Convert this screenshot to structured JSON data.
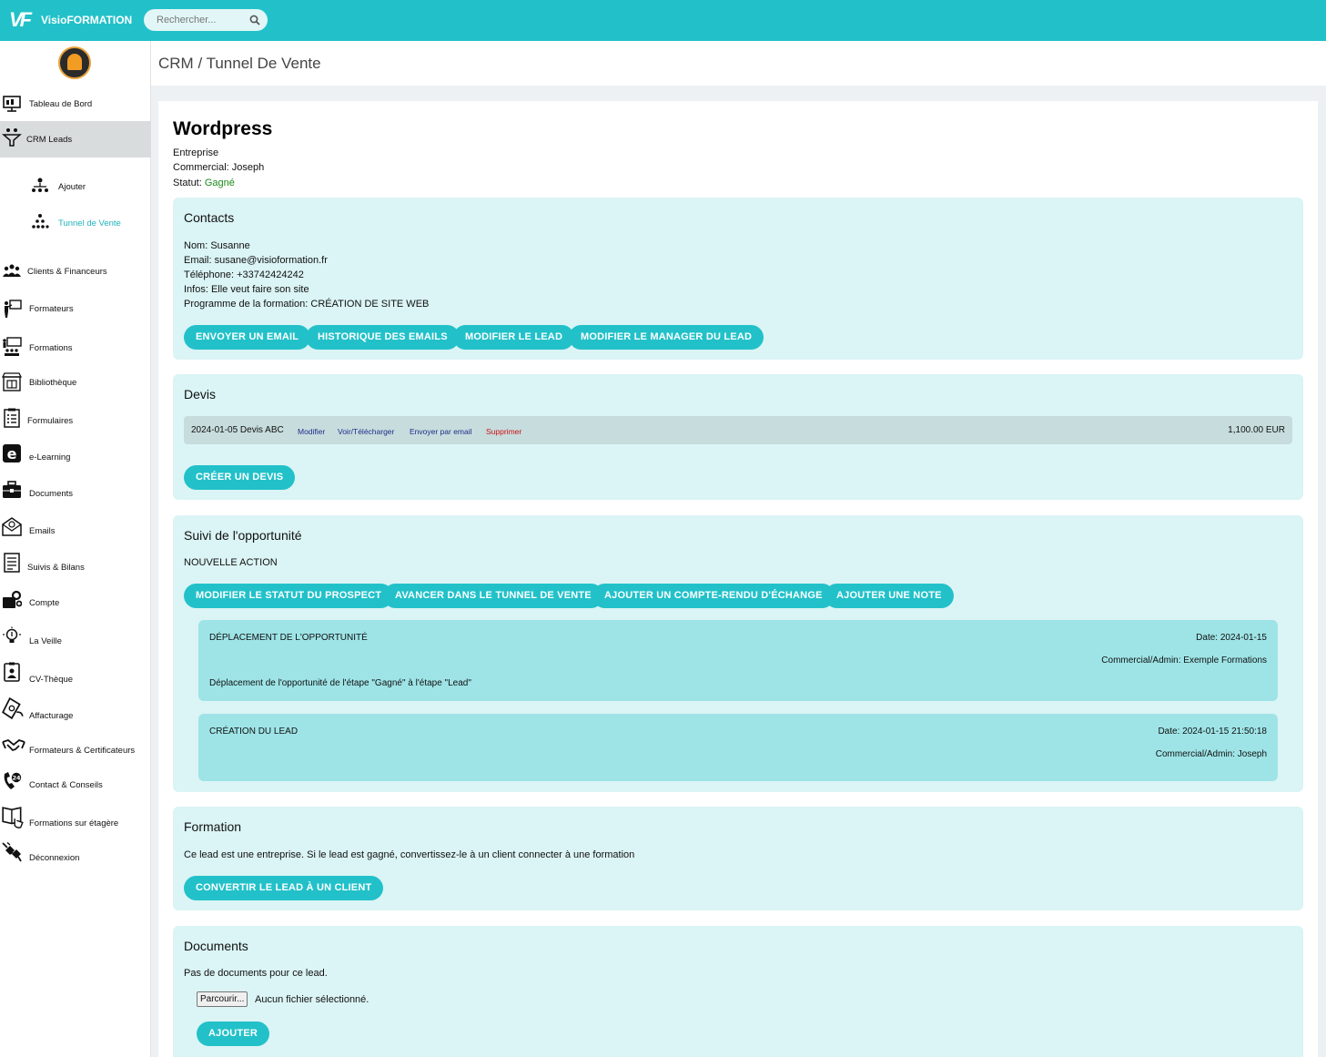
{
  "app": {
    "logo_mark": "VF",
    "logo_text": "VisioFORMATION",
    "brand_color": "#22c1c9"
  },
  "search": {
    "placeholder": "Rechercher..."
  },
  "breadcrumb": "CRM / Tunnel De Vente",
  "sidebar": {
    "items": [
      {
        "label": "Tableau de Bord",
        "icon": "dashboard-icon"
      },
      {
        "label": "CRM Leads",
        "icon": "funnel-people-icon",
        "active": true
      },
      {
        "label": "Clients & Financeurs",
        "icon": "people-group-icon"
      },
      {
        "label": "Formateurs",
        "icon": "trainer-board-icon"
      },
      {
        "label": "Formations",
        "icon": "classroom-icon"
      },
      {
        "label": "Bibliothèque",
        "icon": "library-icon"
      },
      {
        "label": "Formulaires",
        "icon": "clipboard-list-icon"
      },
      {
        "label": "e-Learning",
        "icon": "elearning-icon"
      },
      {
        "label": "Documents",
        "icon": "briefcase-icon"
      },
      {
        "label": "Emails",
        "icon": "envelope-icon"
      },
      {
        "label": "Suivis & Bilans",
        "icon": "report-icon"
      },
      {
        "label": "Compte",
        "icon": "account-gears-icon"
      },
      {
        "label": "La Veille",
        "icon": "lightbulb-icon"
      },
      {
        "label": "CV-Thèque",
        "icon": "id-badge-icon"
      },
      {
        "label": "Affacturage",
        "icon": "money-hand-icon"
      },
      {
        "label": "Formateurs & Certificateurs",
        "icon": "handshake-icon"
      },
      {
        "label": "Contact & Conseils",
        "icon": "phone-24-icon"
      },
      {
        "label": "Formations sur étagère",
        "icon": "book-hand-icon"
      },
      {
        "label": "Déconnexion",
        "icon": "plug-icon"
      }
    ],
    "sub_items": [
      {
        "label": "Ajouter",
        "icon": "org-chart-icon",
        "color": "#111111"
      },
      {
        "label": "Tunnel de Vente",
        "icon": "pyramid-people-icon",
        "color": "#22b3bb"
      }
    ]
  },
  "lead": {
    "title": "Wordpress",
    "type": "Entreprise",
    "commercial": "Commercial: Joseph",
    "status_label": "Statut: ",
    "status_value": "Gagné"
  },
  "contacts": {
    "title": "Contacts",
    "lines": [
      "Nom: Susanne",
      "Email: susane@visioformation.fr",
      "Téléphone: +33742424242",
      "Infos: Elle veut faire son site",
      "Programme de la formation: CRÉATION DE SITE WEB"
    ],
    "buttons": [
      "ENVOYER UN EMAIL",
      "HISTORIQUE DES EMAILS",
      "MODIFIER LE LEAD",
      "MODIFIER LE MANAGER DU LEAD"
    ]
  },
  "devis": {
    "title": "Devis",
    "row": {
      "name": "2024-01-05 Devis ABC",
      "edit": "Modifier",
      "view": "Voir/Télécharger",
      "send": "Envoyer par email",
      "delete": "Supprimer",
      "amount": "1,100.00 EUR"
    },
    "create_button": "CRÉER UN DEVIS"
  },
  "suivi": {
    "title": "Suivi de l'opportunité",
    "new_action": "NOUVELLE ACTION",
    "buttons": [
      "MODIFIER LE STATUT DU PROSPECT",
      "AVANCER DANS LE TUNNEL DE VENTE",
      "AJOUTER UN COMPTE-RENDU D'ÉCHANGE",
      "AJOUTER UNE NOTE"
    ],
    "events": [
      {
        "title": "DÉPLACEMENT DE L'OPPORTUNITÉ",
        "date": "Date: 2024-01-15",
        "author": "Commercial/Admin: Exemple Formations",
        "body": "Déplacement de l'opportunité de l'étape \"Gagné\" à l'étape \"Lead\""
      },
      {
        "title": "CRÉATION DU LEAD",
        "date": "Date: 2024-01-15 21:50:18",
        "author": "Commercial/Admin: Joseph",
        "body": ""
      }
    ]
  },
  "formation": {
    "title": "Formation",
    "text": "Ce lead est une entreprise. Si le lead est gagné, convertissez-le à un client connecter à une formation",
    "button": "CONVERTIR LE LEAD À UN CLIENT"
  },
  "documents": {
    "title": "Documents",
    "empty": "Pas de documents pour ce lead.",
    "browse": "Parcourir...",
    "no_file": "Aucun fichier sélectionné.",
    "add": "AJOUTER"
  }
}
